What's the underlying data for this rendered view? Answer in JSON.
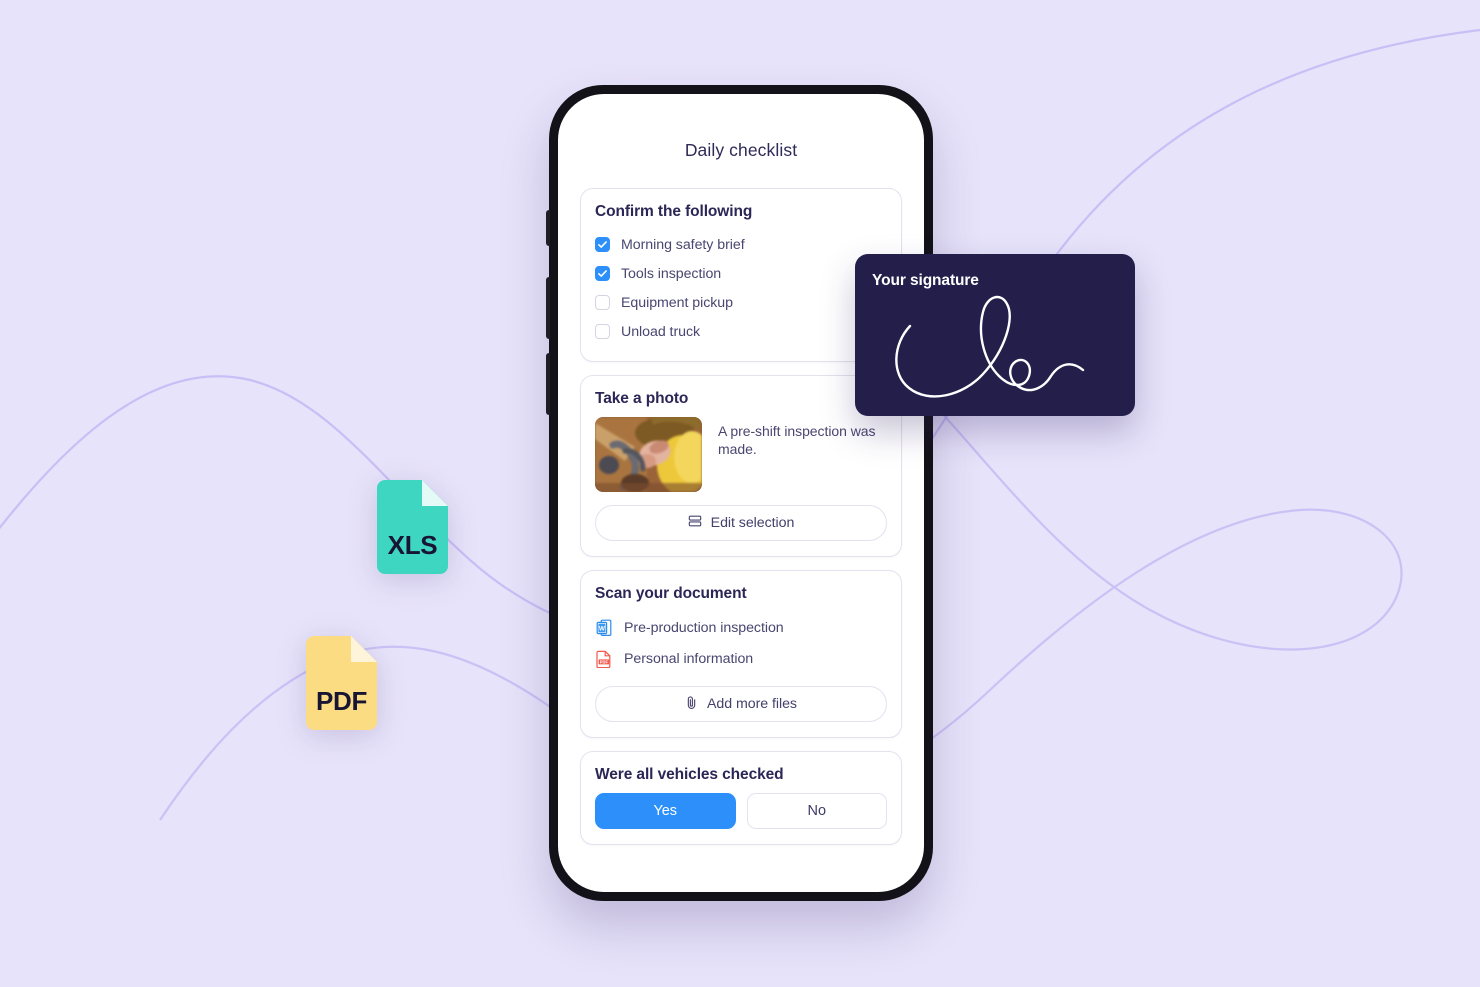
{
  "theme": {
    "background": "#E7E3FA",
    "accent_blue": "#2D90FA",
    "ink_navy": "#241E4B",
    "text_navy": "#2B2656",
    "text_muted": "#4A4670",
    "card_border": "#E3E2EE",
    "swoosh": "#BDB2F2",
    "xls_color": "#3FD6C1",
    "pdf_color": "#FBDC82"
  },
  "phone": {
    "screen_title": "Daily checklist",
    "cards": {
      "confirm": {
        "title": "Confirm the following",
        "items": [
          {
            "label": "Morning safety brief",
            "checked": true
          },
          {
            "label": "Tools inspection",
            "checked": true
          },
          {
            "label": "Equipment pickup",
            "checked": false
          },
          {
            "label": "Unload truck",
            "checked": false
          }
        ]
      },
      "photo": {
        "title": "Take a photo",
        "caption": "A pre-shift inspection was made.",
        "thumbnail_alt": "worker-in-hi-vis-inspecting-machinery",
        "button_label": "Edit selection",
        "button_icon": "stack-list-icon"
      },
      "scan": {
        "title": "Scan your document",
        "files": [
          {
            "name": "Pre-production inspection",
            "icon": "word-document-icon",
            "icon_color": "#2B8CEA"
          },
          {
            "name": "Personal information",
            "icon": "pdf-document-icon",
            "icon_color": "#F4574C"
          }
        ],
        "button_label": "Add more files",
        "button_icon": "paperclip-icon"
      },
      "vehicles": {
        "title": "Were all vehicles checked",
        "options": [
          {
            "label": "Yes",
            "selected": true
          },
          {
            "label": "No",
            "selected": false
          }
        ]
      }
    },
    "hardware_buttons": [
      "mute-switch",
      "volume-up",
      "volume-down"
    ]
  },
  "signature_card": {
    "label": "Your signature",
    "ink_alt": "handwritten-cursive-signature"
  },
  "file_chips": [
    {
      "label": "XLS",
      "color": "#3FD6C1",
      "fold_color": "#E4FAF6"
    },
    {
      "label": "PDF",
      "color": "#FBDC82",
      "fold_color": "#FEF4DA"
    }
  ]
}
